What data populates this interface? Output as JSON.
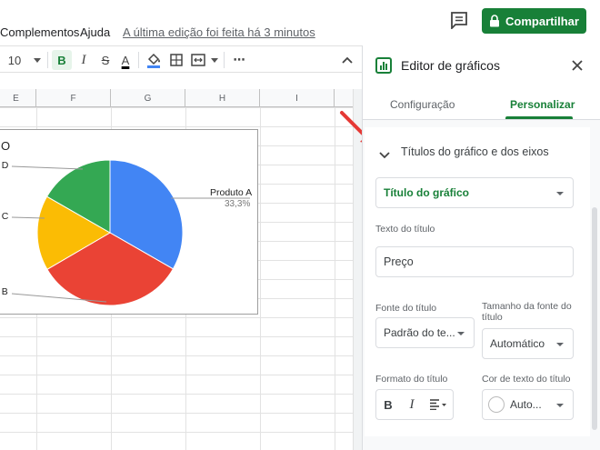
{
  "menu": {
    "complementos": "Complementos",
    "ajuda": "Ajuda",
    "last_edit": "A última edição foi feita há 3 minutos"
  },
  "share": {
    "label": "Compartilhar"
  },
  "toolbar": {
    "font_size": "10",
    "bold": "B",
    "italic": "I",
    "strike": "S",
    "text_color": "A",
    "more": "⋯",
    "collapse": "^"
  },
  "grid": {
    "columns": [
      "E",
      "F",
      "G",
      "H",
      "I"
    ]
  },
  "chart_data": {
    "type": "pie",
    "title": "O",
    "categories": [
      "Produto A",
      "Produto B",
      "Produto C",
      "Produto D"
    ],
    "values": [
      33.3,
      33.3,
      16.7,
      16.7
    ],
    "labels_visible": [
      "Produto A",
      "o B",
      "o C",
      "o D"
    ],
    "data_labels": [
      "33,3%"
    ],
    "colors": [
      "#4285f4",
      "#ea4335",
      "#fbbc04",
      "#34a853"
    ]
  },
  "sidebar": {
    "title": "Editor de gráficos",
    "tabs": [
      "Configuração",
      "Personalizar"
    ],
    "section_header": "Títulos do gráfico e dos eixos",
    "title_type": "Título do gráfico",
    "title_text_label": "Texto do título",
    "title_text_value": "Preço",
    "font_label": "Fonte do título",
    "font_value": "Padrão do te...",
    "font_size_label": "Tamanho da fonte do título",
    "font_size_value": "Automático",
    "format_label": "Formato do título",
    "color_label": "Cor de texto do título",
    "color_value": "Auto...",
    "format_bold": "B",
    "format_italic": "I"
  },
  "colors": {
    "accent": "#188038",
    "arrow": "#e53935"
  }
}
